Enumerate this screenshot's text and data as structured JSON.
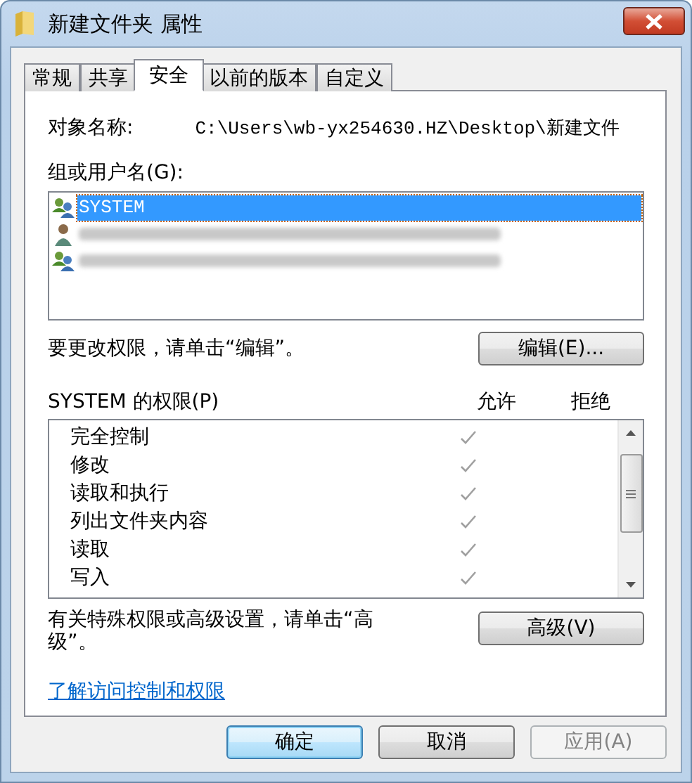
{
  "window": {
    "title": "新建文件夹 属性"
  },
  "tabs": [
    {
      "label": "常规",
      "selected": false
    },
    {
      "label": "共享",
      "selected": false
    },
    {
      "label": "安全",
      "selected": true
    },
    {
      "label": "以前的版本",
      "selected": false
    },
    {
      "label": "自定义",
      "selected": false
    }
  ],
  "object_name": {
    "label": "对象名称:",
    "value": "C:\\Users\\wb-yx254630.HZ\\Desktop\\新建文件"
  },
  "users": {
    "label": "组或用户名(G):",
    "items": [
      {
        "kind": "group",
        "name": "SYSTEM",
        "selected": true,
        "redacted": false
      },
      {
        "kind": "user",
        "selected": false,
        "redacted": true
      },
      {
        "kind": "group",
        "selected": false,
        "redacted": true
      }
    ]
  },
  "edit_hint": "要更改权限，请单击“编辑”。",
  "edit_button": "编辑(E)...",
  "permissions": {
    "label": "SYSTEM 的权限(P)",
    "allow_header": "允许",
    "deny_header": "拒绝",
    "rows": [
      {
        "name": "完全控制",
        "allow": true
      },
      {
        "name": "修改",
        "allow": true
      },
      {
        "name": "读取和执行",
        "allow": true
      },
      {
        "name": "列出文件夹内容",
        "allow": true
      },
      {
        "name": "读取",
        "allow": true
      },
      {
        "name": "写入",
        "allow": true
      }
    ]
  },
  "advanced_hint": "有关特殊权限或高级设置，请单击“高级”。",
  "advanced_button": "高级(V)",
  "link": "了解访问控制和权限",
  "buttons": [
    {
      "label": "确定",
      "kind": "default",
      "disabled": false
    },
    {
      "label": "取消",
      "kind": "normal",
      "disabled": false
    },
    {
      "label": "应用(A)",
      "kind": "normal",
      "disabled": true
    }
  ]
}
